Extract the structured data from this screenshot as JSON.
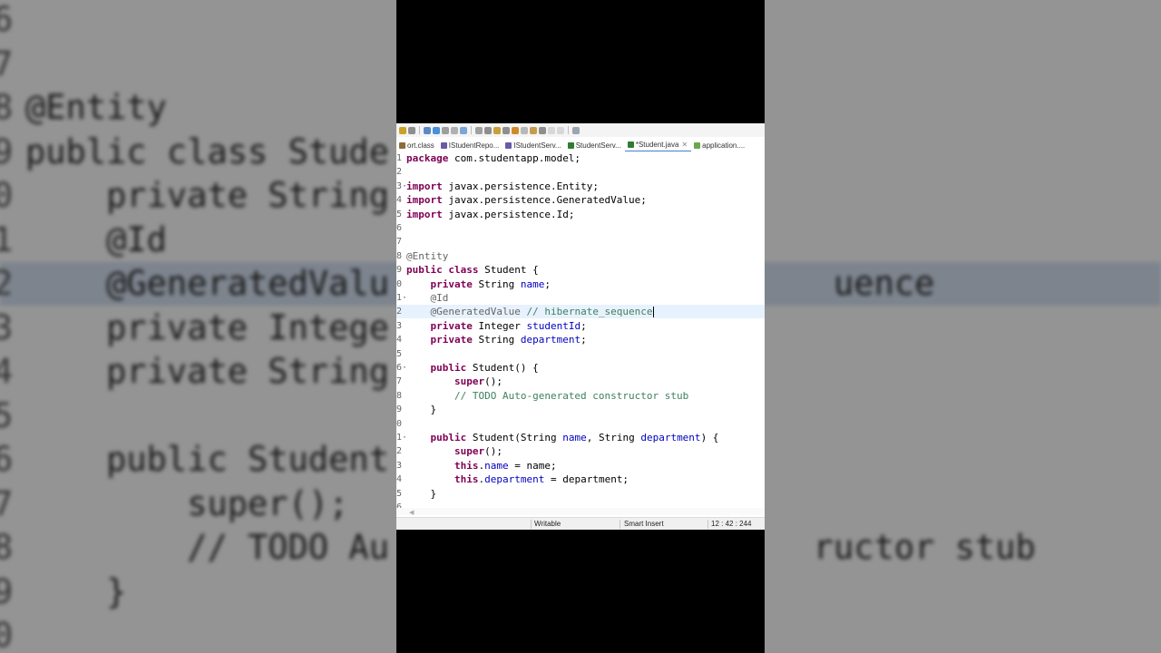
{
  "tabs": [
    {
      "label": "ort.class",
      "icon": "class-file-icon",
      "color": "#8a6d3b"
    },
    {
      "label": "IStudentRepo...",
      "icon": "java-interface-icon",
      "color": "#6b5aa6"
    },
    {
      "label": "IStudentServ...",
      "icon": "java-interface-icon",
      "color": "#6b5aa6"
    },
    {
      "label": "StudentServ...",
      "icon": "java-class-icon",
      "color": "#2e7d32"
    },
    {
      "label": "*Student.java",
      "icon": "java-class-icon",
      "color": "#2e7d32",
      "active": true
    },
    {
      "label": "application....",
      "icon": "properties-file-icon",
      "color": "#6aa84f"
    }
  ],
  "editor": {
    "current_line": 12,
    "lines": [
      {
        "n": "1",
        "tokens": [
          {
            "t": "package",
            "c": "kw"
          },
          {
            "t": " com.studentapp.model;"
          }
        ]
      },
      {
        "n": "2",
        "tokens": []
      },
      {
        "n": "3",
        "fold": true,
        "tokens": [
          {
            "t": "import",
            "c": "kw"
          },
          {
            "t": " javax.persistence.Entity;"
          }
        ]
      },
      {
        "n": "4",
        "tokens": [
          {
            "t": "import",
            "c": "kw"
          },
          {
            "t": " javax.persistence.GeneratedValue;"
          }
        ]
      },
      {
        "n": "5",
        "tokens": [
          {
            "t": "import",
            "c": "kw"
          },
          {
            "t": " javax.persistence.Id;"
          }
        ]
      },
      {
        "n": "6",
        "tokens": []
      },
      {
        "n": "7",
        "tokens": []
      },
      {
        "n": "8",
        "tokens": [
          {
            "t": "@Entity",
            "c": "ann"
          }
        ]
      },
      {
        "n": "9",
        "tokens": [
          {
            "t": "public",
            "c": "kw"
          },
          {
            "t": " "
          },
          {
            "t": "class",
            "c": "kw"
          },
          {
            "t": " Student {"
          }
        ]
      },
      {
        "n": "0",
        "tokens": [
          {
            "t": "    "
          },
          {
            "t": "private",
            "c": "kw"
          },
          {
            "t": " String "
          },
          {
            "t": "name",
            "c": "fld"
          },
          {
            "t": ";"
          }
        ]
      },
      {
        "n": "1",
        "fold": true,
        "tokens": [
          {
            "t": "    "
          },
          {
            "t": "@Id",
            "c": "ann"
          }
        ]
      },
      {
        "n": "2",
        "current": true,
        "tokens": [
          {
            "t": "    "
          },
          {
            "t": "@GeneratedValue",
            "c": "ann"
          },
          {
            "t": " "
          },
          {
            "t": "// hibernate_sequence",
            "c": "cmt"
          },
          {
            "t": "",
            "caret": true
          }
        ]
      },
      {
        "n": "3",
        "tokens": [
          {
            "t": "    "
          },
          {
            "t": "private",
            "c": "kw"
          },
          {
            "t": " Integer "
          },
          {
            "t": "studentId",
            "c": "fld"
          },
          {
            "t": ";"
          }
        ]
      },
      {
        "n": "4",
        "tokens": [
          {
            "t": "    "
          },
          {
            "t": "private",
            "c": "kw"
          },
          {
            "t": " String "
          },
          {
            "t": "department",
            "c": "fld"
          },
          {
            "t": ";"
          }
        ]
      },
      {
        "n": "5",
        "tokens": []
      },
      {
        "n": "6",
        "fold": true,
        "tokens": [
          {
            "t": "    "
          },
          {
            "t": "public",
            "c": "kw"
          },
          {
            "t": " Student() {"
          }
        ]
      },
      {
        "n": "7",
        "tokens": [
          {
            "t": "        "
          },
          {
            "t": "super",
            "c": "kw"
          },
          {
            "t": "();"
          }
        ]
      },
      {
        "n": "8",
        "tokens": [
          {
            "t": "        "
          },
          {
            "t": "// TODO Auto-generated constructor stub",
            "c": "cmt"
          }
        ]
      },
      {
        "n": "9",
        "tokens": [
          {
            "t": "    }"
          }
        ]
      },
      {
        "n": "0",
        "tokens": []
      },
      {
        "n": "1",
        "fold": true,
        "tokens": [
          {
            "t": "    "
          },
          {
            "t": "public",
            "c": "kw"
          },
          {
            "t": " Student(String "
          },
          {
            "t": "name",
            "c": "fld"
          },
          {
            "t": ", String "
          },
          {
            "t": "department",
            "c": "fld"
          },
          {
            "t": ") {"
          }
        ]
      },
      {
        "n": "2",
        "tokens": [
          {
            "t": "        "
          },
          {
            "t": "super",
            "c": "kw"
          },
          {
            "t": "();"
          }
        ]
      },
      {
        "n": "3",
        "tokens": [
          {
            "t": "        "
          },
          {
            "t": "this",
            "c": "kw"
          },
          {
            "t": "."
          },
          {
            "t": "name",
            "c": "fld"
          },
          {
            "t": " = name;"
          }
        ]
      },
      {
        "n": "4",
        "tokens": [
          {
            "t": "        "
          },
          {
            "t": "this",
            "c": "kw"
          },
          {
            "t": "."
          },
          {
            "t": "department",
            "c": "fld"
          },
          {
            "t": " = department;"
          }
        ]
      },
      {
        "n": "5",
        "tokens": [
          {
            "t": "    }"
          }
        ]
      },
      {
        "n": "6",
        "tokens": []
      }
    ]
  },
  "status": {
    "mode": "Writable",
    "insert": "Smart Insert",
    "position": "12 : 42 : 244"
  },
  "background": {
    "lines": [
      {
        "n": "6",
        "text": ""
      },
      {
        "n": "7",
        "text": ""
      },
      {
        "n": "8",
        "text": "@Entity"
      },
      {
        "n": "9",
        "text": "public class Stude"
      },
      {
        "n": "0",
        "text": "    private String"
      },
      {
        "n": "1",
        "text": "    @Id"
      },
      {
        "n": "2",
        "text": "    @GeneratedValu                      uence",
        "hl": true
      },
      {
        "n": "3",
        "text": "    private Intege"
      },
      {
        "n": "4",
        "text": "    private String"
      },
      {
        "n": "5",
        "text": ""
      },
      {
        "n": "6",
        "text": "    public Student"
      },
      {
        "n": "7",
        "text": "        super();"
      },
      {
        "n": "8",
        "text": "        // TODO Au                     ructor stub"
      },
      {
        "n": "9",
        "text": "    }"
      },
      {
        "n": "0",
        "text": ""
      }
    ]
  },
  "colors": {
    "keyword": "#7f0055",
    "annotation": "#646464",
    "comment": "#3f7f5f",
    "field": "#0000c0",
    "current_line": "#e8f2fe"
  }
}
